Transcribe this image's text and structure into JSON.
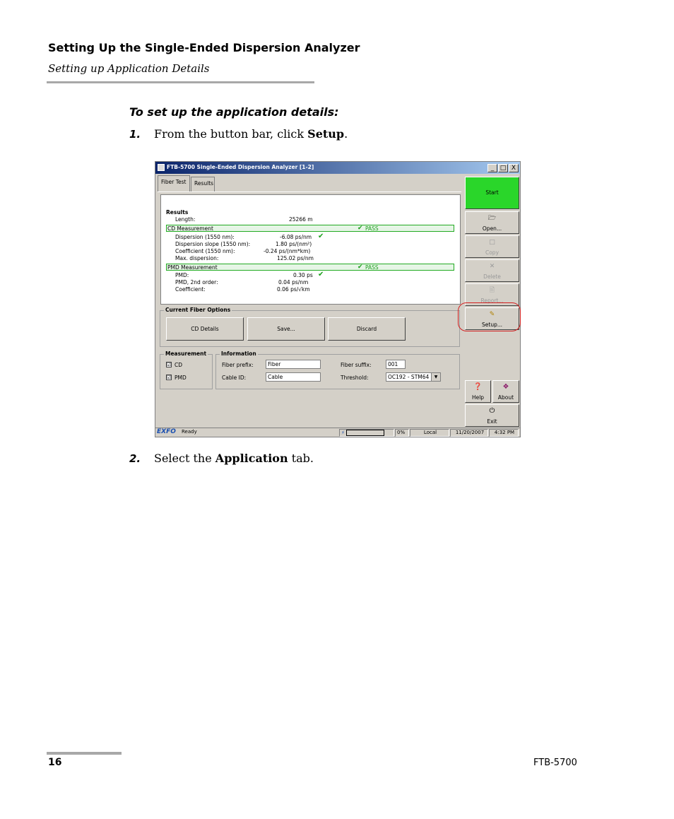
{
  "header": {
    "title": "Setting Up the Single-Ended Dispersion Analyzer",
    "subtitle": "Setting up Application Details"
  },
  "procedure_title": "To set up the application details:",
  "steps": [
    {
      "num": "1.",
      "pre": "From the button bar, click ",
      "bold": "Setup",
      "post": "."
    },
    {
      "num": "2.",
      "pre": "Select the ",
      "bold": "Application",
      "post": " tab."
    }
  ],
  "footer": {
    "page": "16",
    "product": "FTB-5700"
  },
  "app": {
    "title": "FTB-5700 Single-Ended Dispersion Analyzer [1-2]",
    "window_buttons": {
      "minimize": "_",
      "maximize": "□",
      "close": "X"
    },
    "tabs": [
      "Fiber Test",
      "Results"
    ],
    "results": {
      "heading": "Results",
      "length_label": "Length:",
      "length_value": "25266 m",
      "cd_section": "CD Measurement",
      "cd_status": "PASS",
      "cd_rows": [
        {
          "label": "Dispersion (1550 nm):",
          "value": "-6.08 ps/nm",
          "check": "✔"
        },
        {
          "label": "Dispersion slope (1550 nm):",
          "value": "1.80 ps/(nm²)",
          "check": ""
        },
        {
          "label": "Coefficient (1550 nm):",
          "value": "-0.24 ps/(nm*km)",
          "check": ""
        },
        {
          "label": "Max. dispersion:",
          "value": "125.02 ps/nm",
          "check": ""
        }
      ],
      "pmd_section": "PMD Measurement",
      "pmd_status": "PASS",
      "pmd_rows": [
        {
          "label": "PMD:",
          "value": "0.30 ps",
          "check": "✔"
        },
        {
          "label": "PMD, 2nd order:",
          "value": "0.04 ps/nm",
          "check": ""
        },
        {
          "label": "Coefficient:",
          "value": "0.06 ps/√km",
          "check": ""
        }
      ]
    },
    "fiber_options": {
      "label": "Current Fiber Options",
      "buttons": [
        "CD Details",
        "Save...",
        "Discard"
      ]
    },
    "measurement": {
      "label": "Measurement",
      "items": [
        {
          "label": "CD",
          "checked": "☑"
        },
        {
          "label": "PMD",
          "checked": "☑"
        }
      ]
    },
    "information": {
      "label": "Information",
      "fiber_prefix_label": "Fiber prefix:",
      "fiber_prefix_value": "Fiber",
      "cable_id_label": "Cable ID:",
      "cable_id_value": "Cable",
      "fiber_suffix_label": "Fiber suffix:",
      "fiber_suffix_value": "001",
      "threshold_label": "Threshold:",
      "threshold_value": "OC192 - STM64"
    },
    "side": {
      "start": "Start",
      "open": "Open...",
      "copy": "Copy",
      "delete": "Delete",
      "report": "Report...",
      "setup": "Setup...",
      "help": "Help",
      "about": "About",
      "exit": "Exit"
    },
    "status": {
      "logo": "EXFO",
      "ready": "Ready",
      "progress": "0%",
      "mode": "Local",
      "date": "11/20/2007",
      "time": "4:32 PM"
    }
  }
}
